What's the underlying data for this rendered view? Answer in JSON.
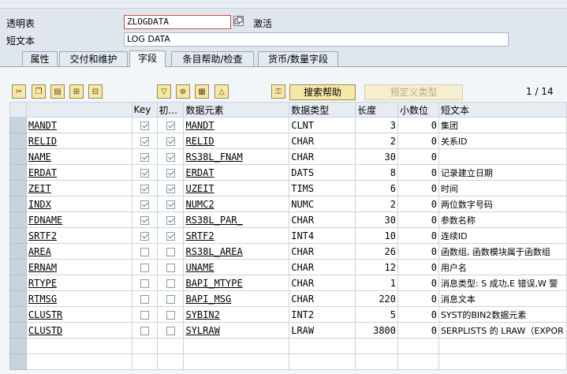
{
  "header": {
    "table_label": "透明表",
    "table_value": "ZLOGDATA",
    "status": "激活",
    "short_text_label": "短文本",
    "short_text_value": "LOG DATA"
  },
  "tabs": [
    {
      "label": "属性"
    },
    {
      "label": "交付和维护"
    },
    {
      "label": "字段"
    },
    {
      "label": "条目帮助/检查"
    },
    {
      "label": "货币/数量字段"
    }
  ],
  "toolbar": {
    "search_help_label": "搜索帮助",
    "predefined_type_label": "预定义类型",
    "pager": "1 / 14"
  },
  "columns": {
    "field": "",
    "key": "Key",
    "init": "初...",
    "data_element": "数据元素",
    "data_type": "数据类型",
    "length": "长度",
    "decimals": "小数位",
    "short_text": "短文本"
  },
  "rows": [
    {
      "field": "MANDT",
      "key": true,
      "init": true,
      "element": "MANDT",
      "type": "CLNT",
      "length": "3",
      "dec": "0",
      "text": "集团"
    },
    {
      "field": "RELID",
      "key": true,
      "init": true,
      "element": "RELID",
      "type": "CHAR",
      "length": "2",
      "dec": "0",
      "text": "关系ID"
    },
    {
      "field": "NAME",
      "key": true,
      "init": true,
      "element": "RS38L_FNAM",
      "type": "CHAR",
      "length": "30",
      "dec": "0",
      "text": ""
    },
    {
      "field": "ERDAT",
      "key": true,
      "init": true,
      "element": "ERDAT",
      "type": "DATS",
      "length": "8",
      "dec": "0",
      "text": "记录建立日期"
    },
    {
      "field": "ZEIT",
      "key": true,
      "init": true,
      "element": "UZEIT",
      "type": "TIMS",
      "length": "6",
      "dec": "0",
      "text": "时间"
    },
    {
      "field": "INDX",
      "key": true,
      "init": true,
      "element": "NUMC2",
      "type": "NUMC",
      "length": "2",
      "dec": "0",
      "text": "两位数字号码"
    },
    {
      "field": "FDNAME",
      "key": true,
      "init": true,
      "element": "RS38L_PAR_",
      "type": "CHAR",
      "length": "30",
      "dec": "0",
      "text": "参数名称"
    },
    {
      "field": "SRTF2",
      "key": true,
      "init": true,
      "element": "SRTF2",
      "type": "INT4",
      "length": "10",
      "dec": "0",
      "text": "连续ID"
    },
    {
      "field": "AREA",
      "key": false,
      "init": false,
      "element": "RS38L_AREA",
      "type": "CHAR",
      "length": "26",
      "dec": "0",
      "text": "函数组, 函数模块属于函数组"
    },
    {
      "field": "ERNAM",
      "key": false,
      "init": false,
      "element": "UNAME",
      "type": "CHAR",
      "length": "12",
      "dec": "0",
      "text": "用户名"
    },
    {
      "field": "RTYPE",
      "key": false,
      "init": false,
      "element": "BAPI_MTYPE",
      "type": "CHAR",
      "length": "1",
      "dec": "0",
      "text": "消息类型: S 成功,E 错误,W 警"
    },
    {
      "field": "RTMSG",
      "key": false,
      "init": false,
      "element": "BAPI_MSG",
      "type": "CHAR",
      "length": "220",
      "dec": "0",
      "text": "消息文本"
    },
    {
      "field": "CLUSTR",
      "key": false,
      "init": false,
      "element": "SYBIN2",
      "type": "INT2",
      "length": "5",
      "dec": "0",
      "text": "SYST的BIN2数据元素"
    },
    {
      "field": "CLUSTD",
      "key": false,
      "init": false,
      "element": "SYLRAW",
      "type": "LRAW",
      "length": "3800",
      "dec": "0",
      "text": "SERPLISTS 的 LRAW（EXPOR"
    }
  ]
}
